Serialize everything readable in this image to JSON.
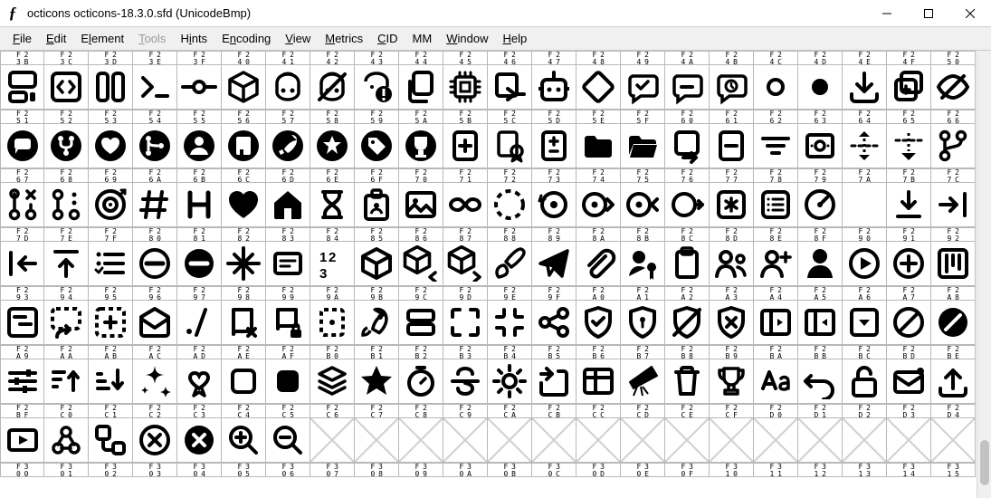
{
  "window": {
    "title": "octicons  octicons-18.3.0.sfd (UnicodeBmp)"
  },
  "menu": {
    "file": "File",
    "edit": "Edit",
    "element": "Element",
    "tools": "Tools",
    "hints": "Hints",
    "encoding": "Encoding",
    "view": "View",
    "metrics": "Metrics",
    "cid": "CID",
    "mm": "MM",
    "window": "Window",
    "help": "Help"
  },
  "grid": {
    "cols": 22,
    "header_rows": [
      [
        "F 2\n3 B",
        "F 2\n3 C",
        "F 2\n3 D",
        "F 2\n3 E",
        "F 2\n3 F",
        "F 2\n4 0",
        "F 2\n4 1",
        "F 2\n4 2",
        "F 2\n4 3",
        "F 2\n4 4",
        "F 2\n4 5",
        "F 2\n4 6",
        "F 2\n4 7",
        "F 2\n4 8",
        "F 2\n4 9",
        "F 2\n4 A",
        "F 2\n4 B",
        "F 2\n4 C",
        "F 2\n4 D",
        "F 2\n4 E",
        "F 2\n4 F",
        "F 2\n5 0"
      ],
      [
        "F 2\n5 1",
        "F 2\n5 2",
        "F 2\n5 3",
        "F 2\n5 4",
        "F 2\n5 5",
        "F 2\n5 6",
        "F 2\n5 7",
        "F 2\n5 8",
        "F 2\n5 9",
        "F 2\n5 A",
        "F 2\n5 B",
        "F 2\n5 C",
        "F 2\n5 D",
        "F 2\n5 E",
        "F 2\n5 F",
        "F 2\n6 0",
        "F 2\n6 1",
        "F 2\n6 2",
        "F 2\n6 3",
        "F 2\n6 4",
        "F 2\n6 5",
        "F 2\n6 6"
      ],
      [
        "F 2\n6 7",
        "F 2\n6 8",
        "F 2\n6 9",
        "F 2\n6 A",
        "F 2\n6 B",
        "F 2\n6 C",
        "F 2\n6 D",
        "F 2\n6 E",
        "F 2\n6 F",
        "F 2\n7 0",
        "F 2\n7 1",
        "F 2\n7 2",
        "F 2\n7 3",
        "F 2\n7 4",
        "F 2\n7 5",
        "F 2\n7 6",
        "F 2\n7 7",
        "F 2\n7 8",
        "F 2\n7 9",
        "F 2\n7 A",
        "F 2\n7 B",
        "F 2\n7 C"
      ],
      [
        "F 2\n7 D",
        "F 2\n7 E",
        "F 2\n7 F",
        "F 2\n8 0",
        "F 2\n8 1",
        "F 2\n8 2",
        "F 2\n8 3",
        "F 2\n8 4",
        "F 2\n8 5",
        "F 2\n8 6",
        "F 2\n8 7",
        "F 2\n8 8",
        "F 2\n8 9",
        "F 2\n8 A",
        "F 2\n8 B",
        "F 2\n8 C",
        "F 2\n8 D",
        "F 2\n8 E",
        "F 2\n8 F",
        "F 2\n9 0",
        "F 2\n9 1",
        "F 2\n9 2"
      ],
      [
        "F 2\n9 3",
        "F 2\n9 4",
        "F 2\n9 5",
        "F 2\n9 6",
        "F 2\n9 7",
        "F 2\n9 8",
        "F 2\n9 9",
        "F 2\n9 A",
        "F 2\n9 B",
        "F 2\n9 C",
        "F 2\n9 D",
        "F 2\n9 E",
        "F 2\n9 F",
        "F 2\nA 0",
        "F 2\nA 1",
        "F 2\nA 2",
        "F 2\nA 3",
        "F 2\nA 4",
        "F 2\nA 5",
        "F 2\nA 6",
        "F 2\nA 7",
        "F 2\nA 8"
      ],
      [
        "F 2\nA 9",
        "F 2\nA A",
        "F 2\nA B",
        "F 2\nA C",
        "F 2\nA D",
        "F 2\nA E",
        "F 2\nA F",
        "F 2\nB 0",
        "F 2\nB 1",
        "F 2\nB 2",
        "F 2\nB 3",
        "F 2\nB 4",
        "F 2\nB 5",
        "F 2\nB 6",
        "F 2\nB 7",
        "F 2\nB 8",
        "F 2\nB 9",
        "F 2\nB A",
        "F 2\nB B",
        "F 2\nB C",
        "F 2\nB D",
        "F 2\nB E"
      ],
      [
        "F 2\nB F",
        "F 2\nC 0",
        "F 2\nC 1",
        "F 2\nC 2",
        "F 2\nC 3",
        "F 2\nC 4",
        "F 2\nC 5",
        "F 2\nC 6",
        "F 2\nC 7",
        "F 2\nC 8",
        "F 2\nC 9",
        "F 2\nC A",
        "F 2\nC B",
        "F 2\nC C",
        "F 2\nC D",
        "F 2\nC E",
        "F 2\nC F",
        "F 2\nD 0",
        "F 2\nD 1",
        "F 2\nD 2",
        "F 2\nD 3",
        "F 2\nD 4"
      ],
      [
        "F 3\n0 0",
        "F 3\n0 1",
        "F 3\n0 2",
        "F 3\n0 3",
        "F 3\n0 4",
        "F 3\n0 5",
        "F 3\n0 6",
        "F 3\n0 7",
        "F 3\n0 8",
        "F 3\n0 9",
        "F 3\n0 A",
        "F 3\n0 B",
        "F 3\n0 C",
        "F 3\n0 D",
        "F 3\n0 E",
        "F 3\n0 F",
        "F 3\n1 0",
        "F 3\n1 1",
        "F 3\n1 2",
        "F 3\n1 3",
        "F 3\n1 4",
        "F 3\n1 5"
      ]
    ],
    "rows": [
      [
        "codespaces",
        "code-square",
        "columns",
        "command-palette",
        "commit",
        "container",
        "copilot",
        "copilot-error",
        "copilot-warning",
        "copy",
        "cpu",
        "cross-reference",
        "dependabot",
        "diamond",
        "discussion-closed",
        "discussion-duplicate",
        "discussion-outdated",
        "dot",
        "dot-fill",
        "download",
        "duplicate",
        "eye-closed"
      ],
      [
        "feed-discussion",
        "feed-forked",
        "feed-heart",
        "feed-merged",
        "feed-person",
        "feed-repo",
        "feed-rocket",
        "feed-star",
        "feed-tag",
        "feed-trophy",
        "file-added",
        "file-badge",
        "file-diff",
        "file-directory-fill",
        "file-directory-open-fill",
        "file-moved",
        "file-removed",
        "filter",
        "fiscal-host",
        "fold",
        "fold-down",
        "git-branch"
      ],
      [
        "git-pull-request-closed",
        "git-pull-request-draft",
        "goal",
        "hash",
        "heading",
        "heart-fill",
        "home-fill",
        "hourglass",
        "id-badge",
        "image",
        "infinity",
        "issue-draft",
        "issue-reopened",
        "issue-tracked-by",
        "issue-tracks",
        "iterations",
        "key-asterisk",
        "log",
        "meter",
        "moon",
        "move-to-bottom",
        "move-to-end"
      ],
      [
        "move-to-start",
        "move-to-top",
        "multi-select",
        "no-entry",
        "no-entry-fill",
        "north-star",
        "note",
        "number",
        "package",
        "package-dependencies",
        "package-dependents",
        "paintbrush",
        "paper-airplane",
        "paperclip",
        "passkey-fill",
        "paste",
        "people",
        "person-add",
        "person-fill",
        "play",
        "plus-circle",
        "project"
      ],
      [
        "project-roadmap",
        "project-symlink",
        "project-template",
        "read",
        "rel-file-path",
        "repo-deleted",
        "repo-locked",
        "repo-template",
        "rocket",
        "rows",
        "screen-full",
        "screen-normal",
        "share-android",
        "shield-check",
        "shield-lock",
        "shield-slash",
        "shield-x",
        "sidebar-collapse",
        "sidebar-expand",
        "single-select",
        "skip",
        "skip-fill"
      ],
      [
        "sliders",
        "sort-asc",
        "sort-desc",
        "sparkle-fill",
        "sponsor-tiers",
        "square",
        "square-fill",
        "stack",
        "star-fill",
        "stopwatch",
        "strikethrough",
        "sun",
        "tab-external",
        "table",
        "telescope-fill",
        "trash",
        "trophy",
        "typography",
        "undo",
        "unlock",
        "unread",
        "upload"
      ],
      [
        "video",
        "webhook",
        "workflow",
        "x-circle",
        "x-circle-fill",
        "zoom-in",
        "zoom-out",
        "empty",
        "empty",
        "empty",
        "empty",
        "empty",
        "empty",
        "empty",
        "empty",
        "empty",
        "empty",
        "empty",
        "empty",
        "empty",
        "empty",
        "empty"
      ]
    ]
  }
}
